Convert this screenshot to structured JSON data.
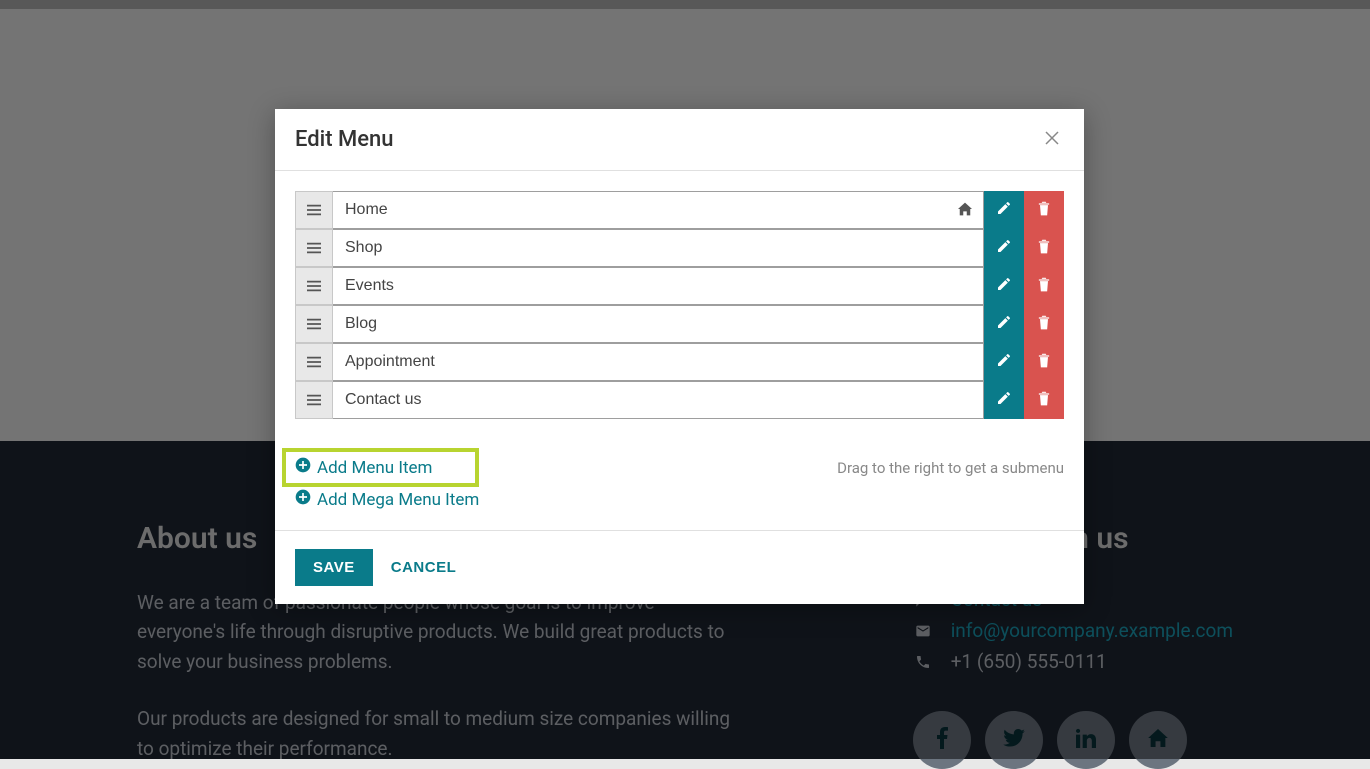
{
  "modal": {
    "title": "Edit Menu",
    "items": [
      {
        "label": "Home",
        "is_home": true
      },
      {
        "label": "Shop",
        "is_home": false
      },
      {
        "label": "Events",
        "is_home": false
      },
      {
        "label": "Blog",
        "is_home": false
      },
      {
        "label": "Appointment",
        "is_home": false
      },
      {
        "label": "Contact us",
        "is_home": false
      }
    ],
    "add_menu_item": "Add Menu Item",
    "add_mega_menu_item": "Add Mega Menu Item",
    "hint": "Drag to the right to get a submenu",
    "save": "SAVE",
    "cancel": "CANCEL"
  },
  "footer": {
    "about_heading": "About us",
    "about_p1": "We are a team of passionate people whose goal is to improve everyone's life through disruptive products. We build great products to solve your business problems.",
    "about_p2": "Our products are designed for small to medium size companies willing to optimize their performance.",
    "connect_heading": "Connect with us",
    "contact_link": "Contact us",
    "email": "info@yourcompany.example.com",
    "phone": "+1 (650) 555-0111"
  }
}
